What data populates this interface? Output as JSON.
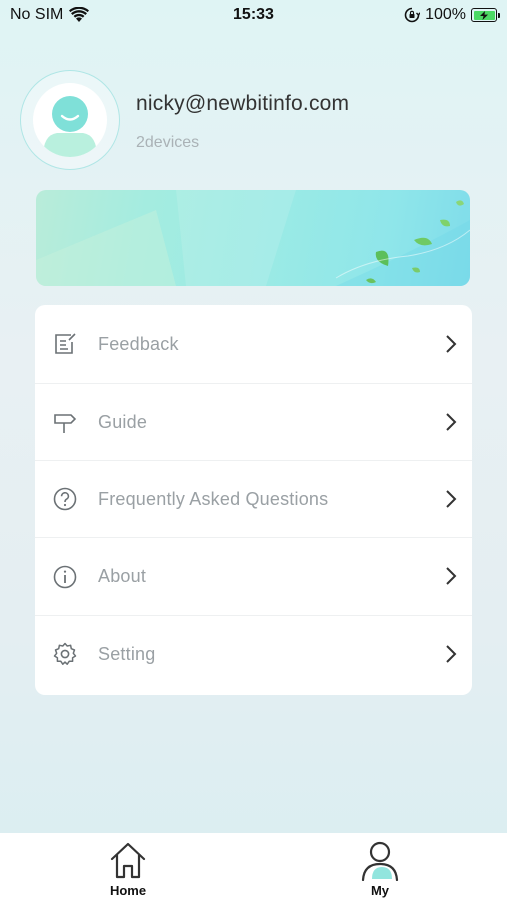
{
  "status_bar": {
    "carrier": "No SIM",
    "time": "15:33",
    "battery": "100%"
  },
  "profile": {
    "email": "nicky@newbitinfo.com",
    "devices": "2devices"
  },
  "menu": {
    "items": [
      {
        "label": "Feedback",
        "icon": "feedback-icon"
      },
      {
        "label": "Guide",
        "icon": "signpost-icon"
      },
      {
        "label": "Frequently Asked Questions",
        "icon": "question-icon"
      },
      {
        "label": "About",
        "icon": "info-icon"
      },
      {
        "label": "Setting",
        "icon": "gear-icon"
      }
    ]
  },
  "tab_bar": {
    "tabs": [
      {
        "label": "Home",
        "icon": "home-icon"
      },
      {
        "label": "My",
        "icon": "person-icon",
        "selected": true
      }
    ]
  },
  "colors": {
    "accent": "#7fe0d8",
    "label_gray": "#9aa0a4"
  }
}
